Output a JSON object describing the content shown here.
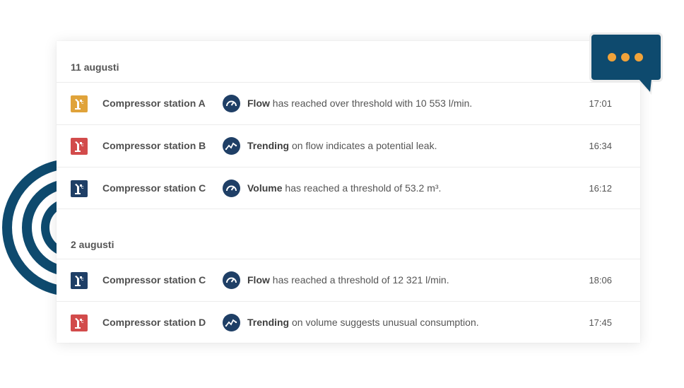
{
  "colors": {
    "accent_navy": "#0e4a6e",
    "icon_navy": "#1f3f66",
    "warning_yellow": "#e0a33a",
    "alert_red": "#d24b4b",
    "dots_orange": "#f1a33a"
  },
  "groups": [
    {
      "date": "11 augusti",
      "events": [
        {
          "station": "Compressor station A",
          "status": "warning",
          "metric_icon": "gauge-icon",
          "keyword": "Flow",
          "message": " has reached over threshold with 10 553 l/min.",
          "time": "17:01"
        },
        {
          "station": "Compressor station B",
          "status": "alert",
          "metric_icon": "trending-icon",
          "keyword": "Trending",
          "message": " on flow indicates a potential leak.",
          "time": "16:34"
        },
        {
          "station": "Compressor station C",
          "status": "normal",
          "metric_icon": "gauge-icon",
          "keyword": "Volume",
          "message": " has reached a threshold of 53.2 m³.",
          "time": "16:12"
        }
      ]
    },
    {
      "date": "2 augusti",
      "events": [
        {
          "station": "Compressor station C",
          "status": "normal",
          "metric_icon": "gauge-icon",
          "keyword": "Flow",
          "message": " has reached a threshold of 12 321 l/min.",
          "time": "18:06"
        },
        {
          "station": "Compressor station D",
          "status": "alert",
          "metric_icon": "trending-icon",
          "keyword": "Trending",
          "message": " on volume suggests unusual consumption.",
          "time": "17:45"
        }
      ]
    }
  ],
  "chat_bubble": {
    "icon": "chat-bubble-icon"
  }
}
